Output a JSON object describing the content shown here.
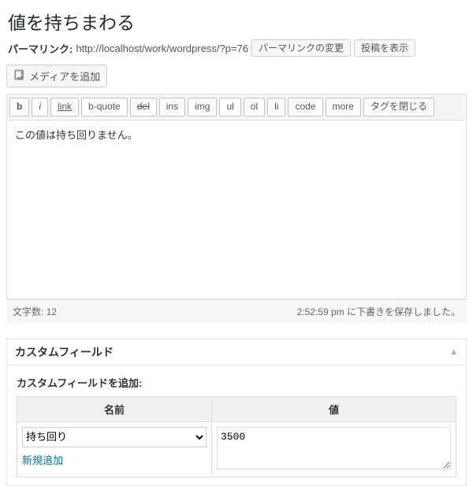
{
  "title": "値を持ちまわる",
  "permalink": {
    "label": "パーマリンク:",
    "url": "http://localhost/work/wordpress/?p=76",
    "edit_button": "パーマリンクの変更",
    "view_button": "投稿を表示"
  },
  "media": {
    "add_label": "メディアを追加"
  },
  "quicktags": {
    "b": "b",
    "i": "i",
    "link": "link",
    "bquote": "b-quote",
    "del": "del",
    "ins": "ins",
    "img": "img",
    "ul": "ul",
    "ol": "ol",
    "li": "li",
    "code": "code",
    "more": "more",
    "close": "タグを閉じる"
  },
  "editor": {
    "content": "この値は持ち回りません。"
  },
  "status": {
    "wordcount_label": "文字数:",
    "wordcount": "12",
    "autosave": "2:52:59 pm に下書きを保存しました。"
  },
  "custom_fields": {
    "box_title": "カスタムフィールド",
    "subtitle": "カスタムフィールドを追加:",
    "col_name": "名前",
    "col_value": "値",
    "select_value": "持ち回り",
    "select_options": [
      "持ち回り"
    ],
    "value": "3500",
    "new_link": "新規追加"
  }
}
